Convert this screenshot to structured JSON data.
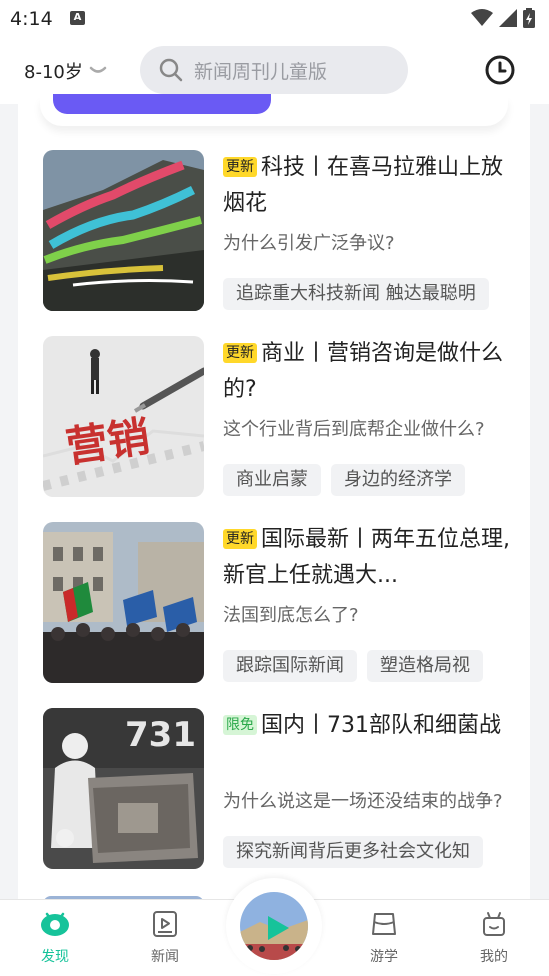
{
  "status": {
    "time": "4:14",
    "a_icon": "A"
  },
  "header": {
    "age_selector": "8-10岁",
    "search_placeholder": "新闻周刊儿童版"
  },
  "items": [
    {
      "tag": "更新",
      "tag_type": "update",
      "title": "科技丨在喜马拉雅山上放烟花",
      "subtitle": "为什么引发广泛争议?",
      "chips": [
        "追踪重大科技新闻 触达最聪明"
      ]
    },
    {
      "tag": "更新",
      "tag_type": "update",
      "title": "商业丨营销咨询是做什么的?",
      "subtitle": "这个行业背后到底帮企业做什么?",
      "chips": [
        "商业启蒙",
        "身边的经济学"
      ],
      "image_text": "营销"
    },
    {
      "tag": "更新",
      "tag_type": "update",
      "title": "国际最新丨两年五位总理,新官上任就遇大...",
      "subtitle": "法国到底怎么了?",
      "chips": [
        "跟踪国际新闻",
        "塑造格局视"
      ]
    },
    {
      "tag": "限免",
      "tag_type": "free",
      "title": "国内丨731部队和细菌战",
      "subtitle": "为什么说这是一场还没结束的战争?",
      "chips": [
        "探究新闻背后更多社会文化知"
      ],
      "image_text": "731"
    }
  ],
  "tabbar": {
    "discover": "发现",
    "news": "新闻",
    "travel": "游学",
    "me": "我的"
  },
  "colors": {
    "accent": "#16c39a",
    "purple": "#6a5af4",
    "update_tag": "#ffd82a",
    "free_tag_text": "#2aa84a"
  }
}
